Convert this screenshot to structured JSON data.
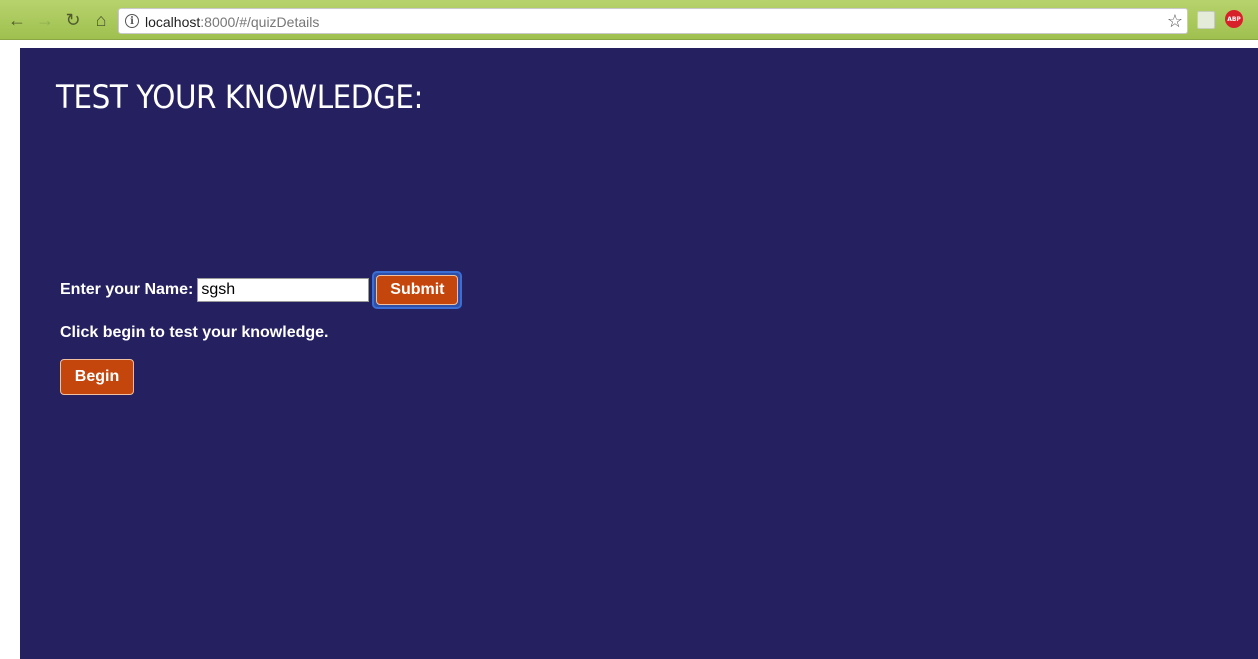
{
  "browser": {
    "url_host": "localhost",
    "url_rest": ":8000/#/quizDetails",
    "info_glyph": "i",
    "abp_label": "ABP",
    "icons": [
      "back-icon",
      "forward-icon",
      "reload-icon",
      "home-icon",
      "info-icon",
      "star-icon",
      "extension-icon",
      "adblock-plus-icon"
    ]
  },
  "page": {
    "title": "TEST YOUR KNOWLEDGE:",
    "name_label": "Enter your Name:",
    "name_value": "sgsh",
    "submit_label": "Submit",
    "hint": "Click begin to test your knowledge.",
    "begin_label": "Begin"
  },
  "colors": {
    "page_background": "#252161",
    "button": "#c4460c",
    "toolbar": "#a9c85c"
  }
}
